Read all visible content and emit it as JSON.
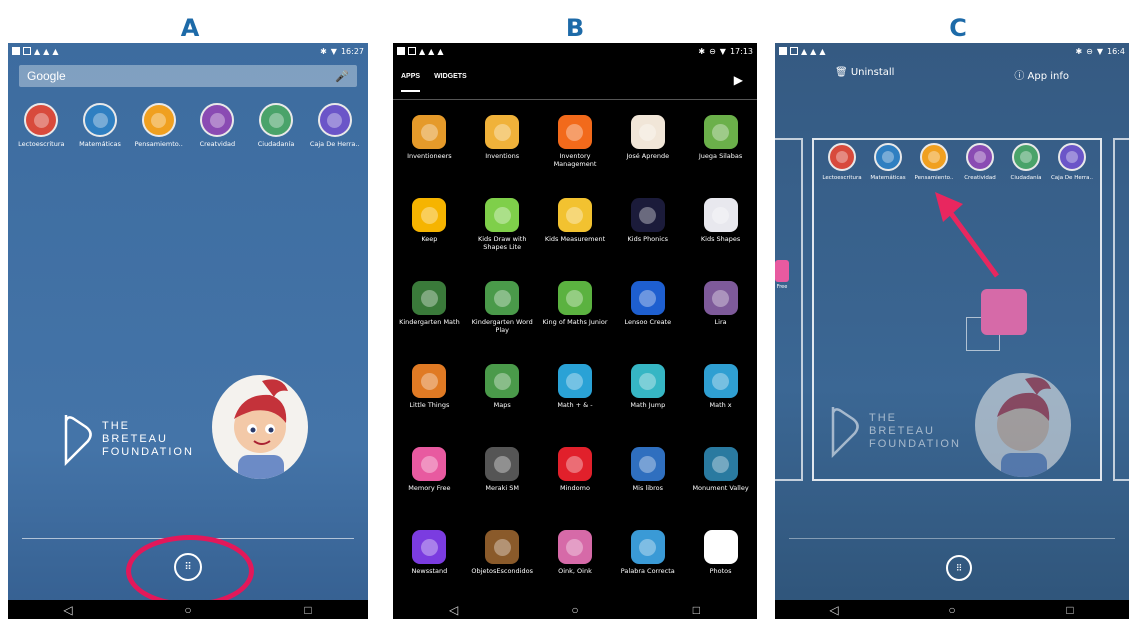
{
  "labels": {
    "a": "A",
    "b": "B",
    "c": "C"
  },
  "status": {
    "a_time": "16:27",
    "b_time": "17:13",
    "c_time": "16:4"
  },
  "panel_a": {
    "search_text": "Google",
    "home_apps": [
      {
        "label": "Lectoescritura",
        "color": "#d84a3c"
      },
      {
        "label": "Matemáticas",
        "color": "#2f7fc1"
      },
      {
        "label": "Pensamiemto..",
        "color": "#f0a020"
      },
      {
        "label": "Creatvidad",
        "color": "#8a4bb3"
      },
      {
        "label": "Ciudadanía",
        "color": "#4aa36a"
      },
      {
        "label": "Caja De Herra..",
        "color": "#6b55c8"
      }
    ],
    "foundation": {
      "line1": "THE",
      "line2": "BRETEAU",
      "line3": "FOUNDATION"
    },
    "drawer_icon": "app-drawer-icon"
  },
  "panel_b": {
    "tabs": [
      "APPS",
      "WIDGETS"
    ],
    "apps": [
      {
        "label": "Inventioneers",
        "color": "#e59a2a"
      },
      {
        "label": "Inventions",
        "color": "#f0b23a"
      },
      {
        "label": "Inventory Management",
        "color": "#f26a1b"
      },
      {
        "label": "José Aprende",
        "color": "#f1e6d8"
      },
      {
        "label": "Juega Silabas",
        "color": "#6bb04a"
      },
      {
        "label": "Keep",
        "color": "#f6b400"
      },
      {
        "label": "Kids Draw with Shapes Lite",
        "color": "#7fcf4a"
      },
      {
        "label": "Kids Measurement",
        "color": "#f2c230"
      },
      {
        "label": "Kids Phonics",
        "color": "#1b1b3a"
      },
      {
        "label": "Kids Shapes",
        "color": "#e8e8ee"
      },
      {
        "label": "Kindergarten Math",
        "color": "#3a7a3a"
      },
      {
        "label": "Kindergarten Word Play",
        "color": "#4a9a4a"
      },
      {
        "label": "King of Maths Junior",
        "color": "#5bb240"
      },
      {
        "label": "Lensoo Create",
        "color": "#1e5fd0"
      },
      {
        "label": "Lira",
        "color": "#7e5a9a"
      },
      {
        "label": "Little Things",
        "color": "#e07a24"
      },
      {
        "label": "Maps",
        "color": "#4a9a4a"
      },
      {
        "label": "Math + & -",
        "color": "#2aa2d6"
      },
      {
        "label": "Math Jump",
        "color": "#36b6c4"
      },
      {
        "label": "Math x",
        "color": "#2f9fd2"
      },
      {
        "label": "Memory Free",
        "color": "#e85aa0"
      },
      {
        "label": "Meraki SM",
        "color": "#555555"
      },
      {
        "label": "Mindomo",
        "color": "#e1202b"
      },
      {
        "label": "Mis libros",
        "color": "#2f6fbf"
      },
      {
        "label": "Monument Valley",
        "color": "#2a7aa0"
      },
      {
        "label": "Newsstand",
        "color": "#7b3ce0"
      },
      {
        "label": "ObjetosEscondidos",
        "color": "#8a5a2a"
      },
      {
        "label": "Oink, Oink",
        "color": "#d66aa8"
      },
      {
        "label": "Palabra Correcta",
        "color": "#3a9ad6"
      },
      {
        "label": "Photos",
        "color": "#ffffff"
      }
    ]
  },
  "panel_c": {
    "uninstall": "Uninstall",
    "app_info": "App info",
    "home_apps": [
      {
        "label": "Lectoescritura",
        "color": "#d84a3c"
      },
      {
        "label": "Matemáticas",
        "color": "#2f7fc1"
      },
      {
        "label": "Pensamiento..",
        "color": "#f0a020"
      },
      {
        "label": "Creatividad",
        "color": "#8a4bb3"
      },
      {
        "label": "Ciudadanía",
        "color": "#4aa36a"
      },
      {
        "label": "Caja De Herra..",
        "color": "#6b55c8"
      }
    ],
    "left_peek_label": "Free",
    "foundation": {
      "line1": "THE",
      "line2": "BRETEAU",
      "line3": "FOUNDATION"
    },
    "dragged_app_color": "#d66aa8",
    "arrow_color": "#e8275f"
  }
}
